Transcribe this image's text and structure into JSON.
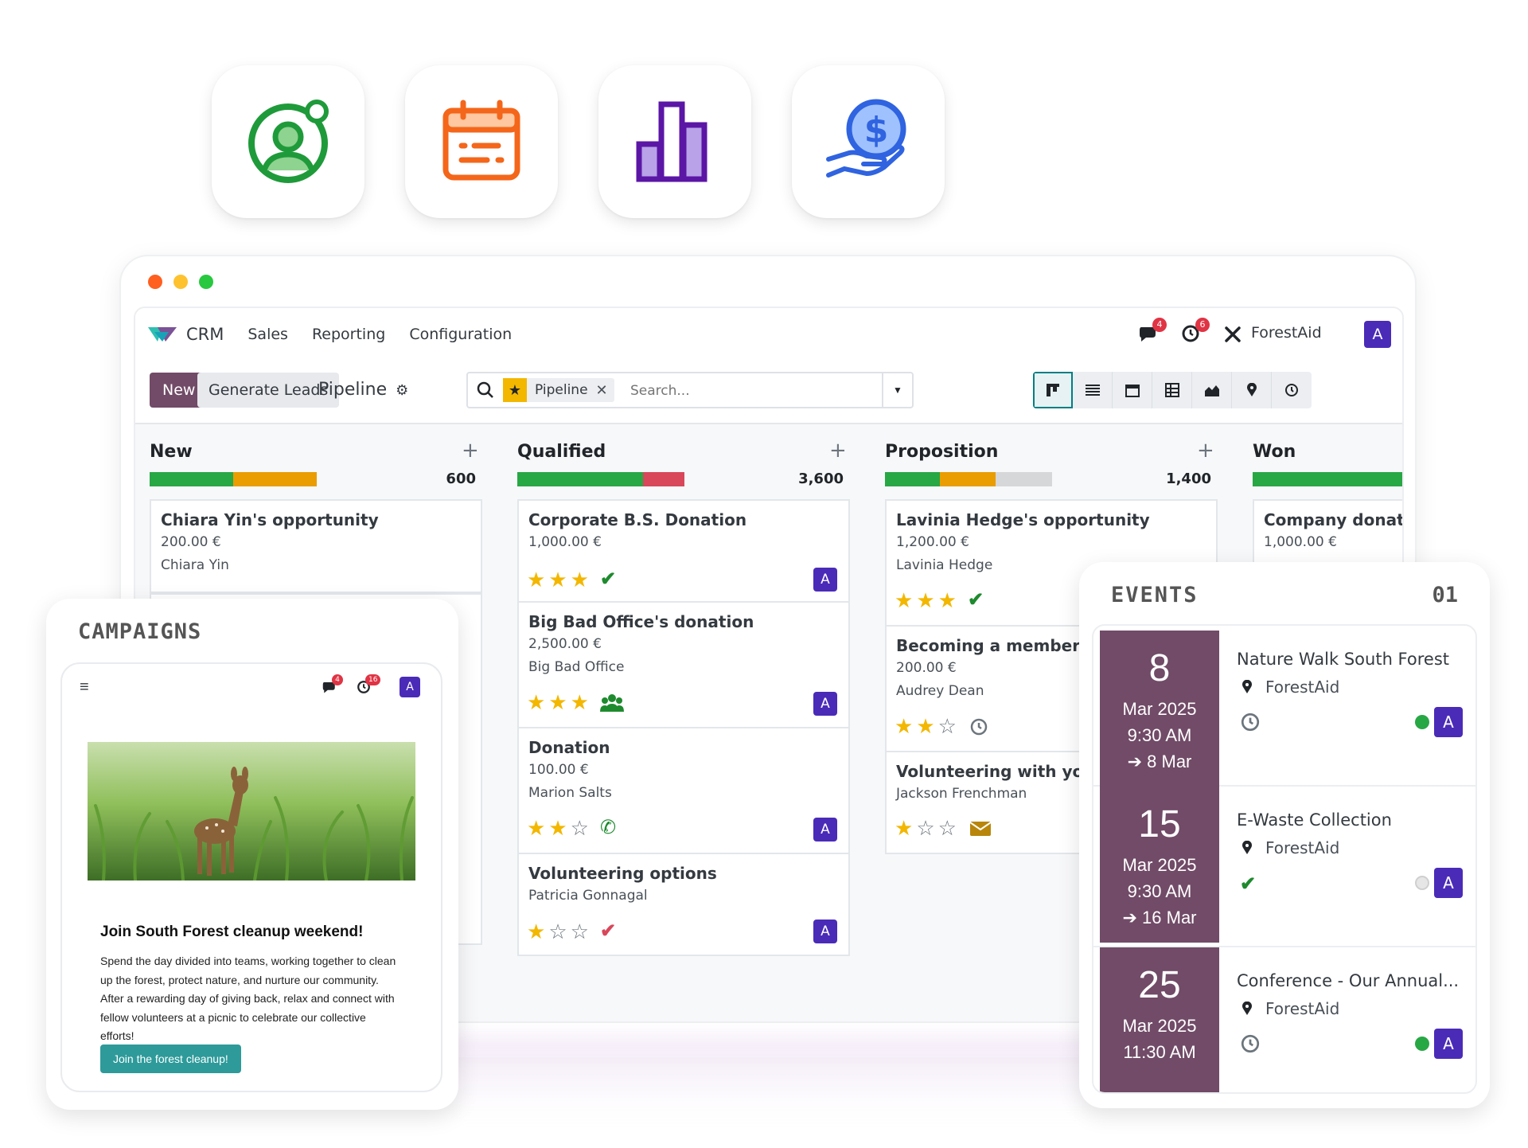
{
  "colors": {
    "brand": "#714b67",
    "avatar": "#4a2bb8",
    "green": "#28a745",
    "orange": "#e99d00",
    "red": "#d9475a",
    "grey": "#d6d7d9",
    "star": "#f3b700",
    "teal": "#017e84"
  },
  "app_icons": [
    "contacts-icon",
    "calendar-icon",
    "bar-chart-icon",
    "donation-hand-icon"
  ],
  "navbar": {
    "app_name": "CRM",
    "menu": [
      "Sales",
      "Reporting",
      "Configuration"
    ],
    "messages_count": "4",
    "activities_count": "6",
    "company": "ForestAid",
    "user_initial": "A"
  },
  "control": {
    "new_label": "New",
    "generate_label": "Generate Leads",
    "breadcrumb": "Pipeline",
    "facet": "Pipeline",
    "search_placeholder": "Search..."
  },
  "columns": [
    {
      "title": "New",
      "total": "600",
      "progress": [
        {
          "color": "green",
          "pct": 0.5
        },
        {
          "color": "orange",
          "pct": 0.5
        }
      ],
      "cards": [
        {
          "title": "Chiara Yin's opportunity",
          "amount": "200.00 €",
          "contact": "Chiara Yin"
        }
      ]
    },
    {
      "title": "Qualified",
      "total": "3,600",
      "progress": [
        {
          "color": "green",
          "pct": 0.75
        },
        {
          "color": "red",
          "pct": 0.25
        }
      ],
      "cards": [
        {
          "title": "Corporate B.S. Donation",
          "amount": "1,000.00 €",
          "stars": 3,
          "activity": "check-icon"
        },
        {
          "title": "Big Bad Office's donation",
          "amount": "2,500.00 €",
          "contact": "Big Bad Office",
          "stars": 3,
          "activity": "meeting-icon"
        },
        {
          "title": "Donation",
          "amount": "100.00 €",
          "contact": "Marion Salts",
          "stars": 2,
          "activity": "phone-icon"
        },
        {
          "title": "Volunteering options",
          "contact": "Patricia Gonnagal",
          "stars": 1,
          "activity": "check-icon"
        }
      ]
    },
    {
      "title": "Proposition",
      "total": "1,400",
      "progress": [
        {
          "color": "green",
          "pct": 0.33
        },
        {
          "color": "orange",
          "pct": 0.33
        },
        {
          "color": "grey",
          "pct": 0.34
        }
      ],
      "cards": [
        {
          "title": "Lavinia Hedge's opportunity",
          "amount": "1,200.00 €",
          "contact": "Lavinia Hedge",
          "stars": 3,
          "activity": "check-icon"
        },
        {
          "title": "Becoming a member",
          "amount": "200.00 €",
          "contact": "Audrey Dean",
          "stars": 2,
          "activity": "clock-icon"
        },
        {
          "title": "Volunteering with you?",
          "contact": "Jackson Frenchman",
          "stars": 1,
          "activity": "envelope-icon"
        }
      ]
    },
    {
      "title": "Won",
      "progress": [
        {
          "color": "green",
          "pct": 1
        }
      ],
      "cards": [
        {
          "title": "Company donation",
          "amount": "1,000.00 €"
        }
      ]
    }
  ],
  "campaigns": {
    "panel_title": "CAMPAIGNS",
    "messages_count": "4",
    "activities_count": "16",
    "user_initial": "A",
    "image": "fawn-in-field-photo",
    "heading": "Join South Forest cleanup weekend!",
    "body": "Spend the day divided into teams, working together to clean up the forest, protect nature, and nurture our community. After a rewarding day of giving back, relax and connect with fellow volunteers at a picnic to celebrate our collective efforts!",
    "cta": "Join the forest cleanup!"
  },
  "events": {
    "panel_title": "EVENTS",
    "count": "01",
    "items": [
      {
        "day": "8",
        "month": "Mar 2025",
        "time": "9:30 AM",
        "end": "8 Mar",
        "name": "Nature Walk South Forest",
        "org": "ForestAid",
        "status": "clock-icon",
        "dot": "green",
        "user": "A"
      },
      {
        "day": "15",
        "month": "Mar 2025",
        "time": "9:30 AM",
        "end": "16 Mar",
        "name": "E-Waste Collection",
        "org": "ForestAid",
        "status": "check-icon",
        "dot": "grey",
        "user": "A"
      },
      {
        "day": "25",
        "month": "Mar 2025",
        "time": "11:30 AM",
        "end": "",
        "name": "Conference - Our Annual...",
        "org": "ForestAid",
        "status": "clock-icon",
        "dot": "green",
        "user": "A"
      }
    ]
  }
}
